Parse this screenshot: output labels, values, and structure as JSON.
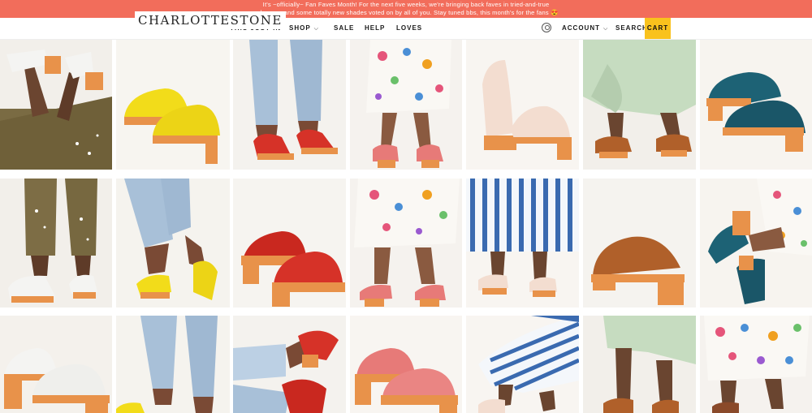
{
  "announcement": {
    "line1": "It's ~officially~ Fan Faves Month! For the next five weeks, we're bringing back faves in tried-and-true",
    "line2": "colorways and some totally new shades voted on by all of you. Stay tuned bbs, this month's for the fans 😍"
  },
  "header": {
    "logo": "CHARLOTTESTONE",
    "nav": {
      "this_just_in": "THIS JUST IN",
      "shop": "SHOP",
      "sale": "SALE",
      "help": "HELP",
      "loves": "LOVES"
    },
    "account": "ACCOUNT",
    "search": "SEARCH",
    "cart": "CART"
  },
  "colors": {
    "announcement_bg": "#f26d5b",
    "cart_bg": "#f9c21d",
    "yellow_clog": "#f2dc1a",
    "red_clog": "#d63228",
    "pink_clog": "#e77a78",
    "cream_clog": "#f3ddd0",
    "teal_clog": "#1d6275",
    "white_clog": "#f4f4f2",
    "tan_clog": "#b0602a",
    "wood": "#e8924a"
  },
  "grid_images": [
    "legs-olive-pants-white-clogs",
    "yellow-suede-clogs-pair",
    "jeans-red-suede-clogs",
    "floral-skirt-pink-clogs",
    "cream-leather-clogs-pair",
    "green-pants-tan-clogs",
    "teal-suede-clogs-pair",
    "olive-paint-pants-white-clogs",
    "jeans-yellow-clogs",
    "red-suede-clogs-pair",
    "floral-skirt-pink-clogs-2",
    "striped-pants-cream-clogs",
    "tan-leather-clog-single",
    "floral-teal-clogs",
    "white-leather-clogs-pair",
    "jeans-yellow-clogs-2",
    "jeans-red-clogs-stepping",
    "pink-suede-clogs-pair",
    "striped-skirt-cream-clogs",
    "green-pants-tan-clogs-2",
    "floral-skirt-brown-clogs"
  ]
}
